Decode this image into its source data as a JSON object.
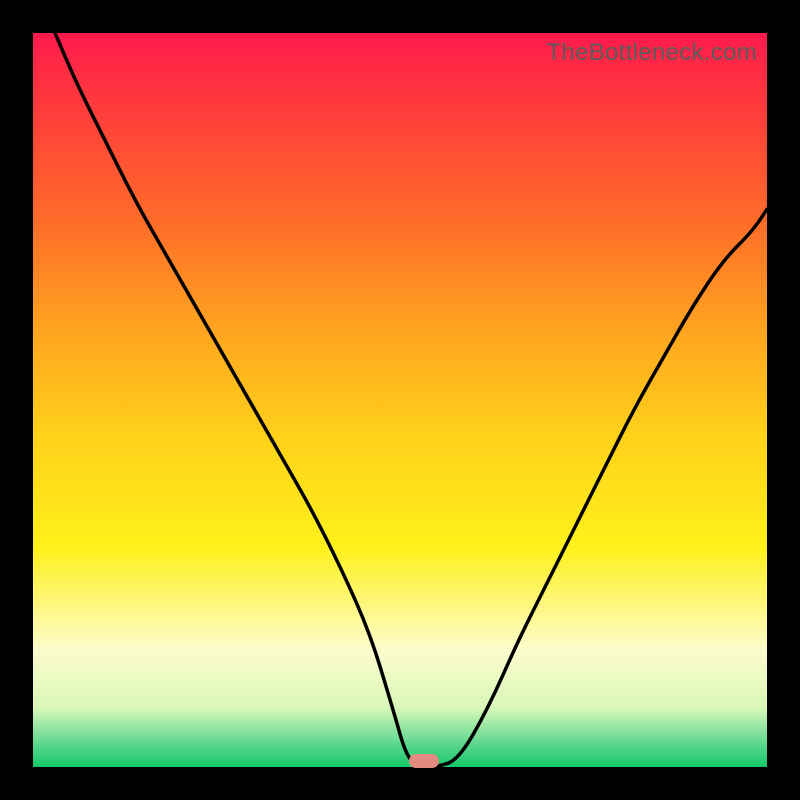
{
  "watermark": "TheBottleneck.com",
  "marker": {
    "color": "#e38b81",
    "x_frac": 0.533,
    "y_frac": 0.992
  },
  "chart_data": {
    "type": "line",
    "title": "",
    "xlabel": "",
    "ylabel": "",
    "xlim": [
      0,
      100
    ],
    "ylim": [
      0,
      100
    ],
    "grid": false,
    "series": [
      {
        "name": "bottleneck-curve",
        "x": [
          3,
          6,
          10,
          14,
          18,
          22,
          26,
          30,
          34,
          38,
          42,
          46,
          49,
          51,
          53,
          55,
          58,
          62,
          66,
          70,
          74,
          78,
          82,
          86,
          90,
          94,
          98,
          100
        ],
        "y": [
          100,
          93,
          85,
          77,
          70,
          63,
          56,
          49,
          42,
          35,
          27,
          18,
          8,
          1,
          0,
          0,
          1,
          8,
          17,
          25,
          33,
          41,
          49,
          56,
          63,
          69,
          73,
          76
        ]
      }
    ],
    "annotations": [
      {
        "type": "marker",
        "x": 53.3,
        "y": 0.8,
        "shape": "rounded-rect",
        "color": "#e38b81"
      }
    ],
    "background_gradient": {
      "direction": "vertical",
      "stops": [
        {
          "pos": 0.0,
          "color": "#ff1a4d"
        },
        {
          "pos": 0.1,
          "color": "#ff3b3b"
        },
        {
          "pos": 0.25,
          "color": "#ff6a2a"
        },
        {
          "pos": 0.4,
          "color": "#ffa220"
        },
        {
          "pos": 0.55,
          "color": "#ffd21a"
        },
        {
          "pos": 0.7,
          "color": "#fff01a"
        },
        {
          "pos": 0.84,
          "color": "#fdfccc"
        },
        {
          "pos": 0.92,
          "color": "#d8f7b8"
        },
        {
          "pos": 0.97,
          "color": "#58d68d"
        },
        {
          "pos": 1.0,
          "color": "#16c96b"
        }
      ]
    }
  }
}
